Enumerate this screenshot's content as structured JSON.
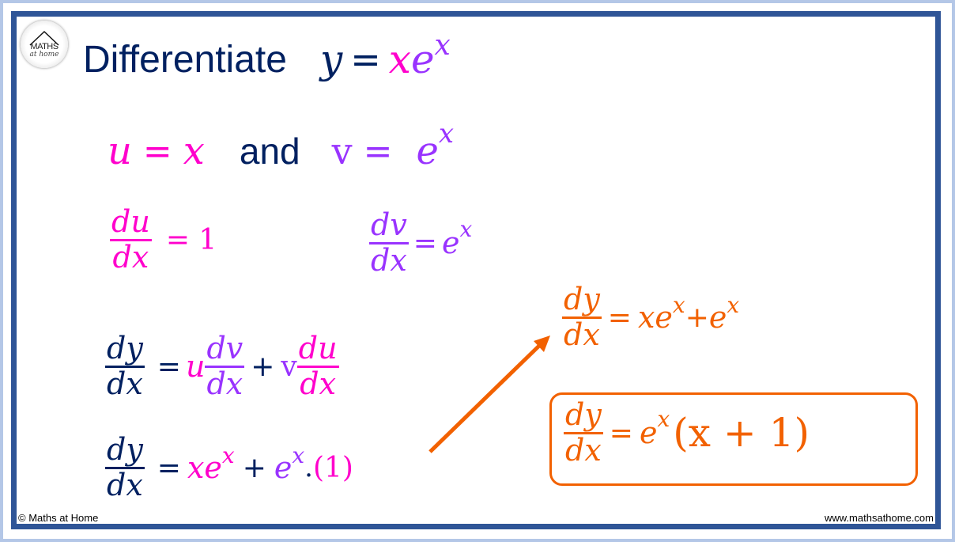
{
  "logo": {
    "line1": "MATHS",
    "line2": "at home"
  },
  "title": {
    "text": "Differentiate",
    "equation": {
      "y": "y",
      "eq": "=",
      "x": "x",
      "e": "e",
      "exp": "x"
    }
  },
  "uv_line": {
    "u": "u",
    "eq1": "=",
    "x": "x",
    "and": "and",
    "v": "v",
    "eq2": "=",
    "e": "e",
    "exp": "x"
  },
  "derivs": {
    "du": {
      "num": "du",
      "den": "dx",
      "rhs": "= 1"
    },
    "dv": {
      "num": "dv",
      "den": "dx",
      "eq": "=",
      "e": "e",
      "exp": "x"
    }
  },
  "product_rule": {
    "lhs": {
      "num": "dy",
      "den": "dx"
    },
    "eq": "=",
    "u": "u",
    "f1": {
      "num": "dv",
      "den": "dx"
    },
    "plus": "+",
    "v": "v",
    "f2": {
      "num": "du",
      "den": "dx"
    }
  },
  "substituted": {
    "lhs": {
      "num": "dy",
      "den": "dx"
    },
    "eq": "=",
    "x": "x",
    "e1": "e",
    "exp1": "x",
    "plus": "+",
    "e2": "e",
    "exp2": "x",
    "dot": ".",
    "one": "(1)"
  },
  "simplified": {
    "lhs": {
      "num": "dy",
      "den": "dx"
    },
    "eq": "=",
    "x": "x",
    "e1": "e",
    "exp1": "x",
    "plus": "+",
    "e2": "e",
    "exp2": "x"
  },
  "answer": {
    "lhs": {
      "num": "dy",
      "den": "dx"
    },
    "eq": "=",
    "e": "e",
    "exp": "x",
    "factor": "(x + 1)"
  },
  "footer": {
    "left": "© Maths at Home",
    "right": "www.mathsathome.com"
  },
  "colors": {
    "navy": "#002060",
    "pink": "#ff00cc",
    "purple": "#9933ff",
    "orange": "#f26100",
    "frame": "#2f5597",
    "outer": "#b4c7e7"
  }
}
